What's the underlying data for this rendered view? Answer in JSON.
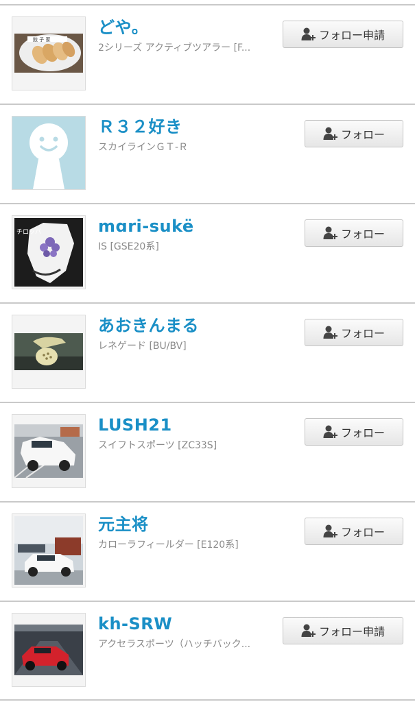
{
  "users": [
    {
      "name": "どや。",
      "car": "2シリーズ アクティブツアラー [F...",
      "follow_label": "フォロー申請",
      "follow_icon": "user-plus-icon",
      "avatar": "photo-gyoza"
    },
    {
      "name": "Ｒ３２好き",
      "car": "スカイラインＧＴ-Ｒ",
      "follow_label": "フォロー",
      "follow_icon": "user-plus-icon",
      "avatar": "default-avatar"
    },
    {
      "name": "mɑri-sukë",
      "car": "IS [GSE20系]",
      "follow_label": "フォロー",
      "follow_icon": "user-plus-icon",
      "avatar": "photo-fox-mask",
      "avatar_text": "チロッパ"
    },
    {
      "name": "あおきんまる",
      "car": "レネゲード [BU/BV]",
      "follow_label": "フォロー",
      "follow_icon": "user-plus-icon",
      "avatar": "photo-dashboard-toy"
    },
    {
      "name": "LUSH21",
      "car": "スイフトスポーツ [ZC33S]",
      "follow_label": "フォロー",
      "follow_icon": "user-plus-icon",
      "avatar": "photo-white-swift"
    },
    {
      "name": "元主将",
      "car": "カローラフィールダー [E120系]",
      "follow_label": "フォロー",
      "follow_icon": "user-plus-icon",
      "avatar": "photo-white-corolla"
    },
    {
      "name": "kh-SRW",
      "car": "アクセラスポーツ（ハッチバック...",
      "follow_label": "フォロー申請",
      "follow_icon": "user-plus-icon",
      "avatar": "photo-red-mazda"
    }
  ],
  "colors": {
    "name": "#1a8fc6",
    "subtext": "#8a8a8a",
    "divider": "#c9c9c9",
    "button_text": "#333333"
  }
}
